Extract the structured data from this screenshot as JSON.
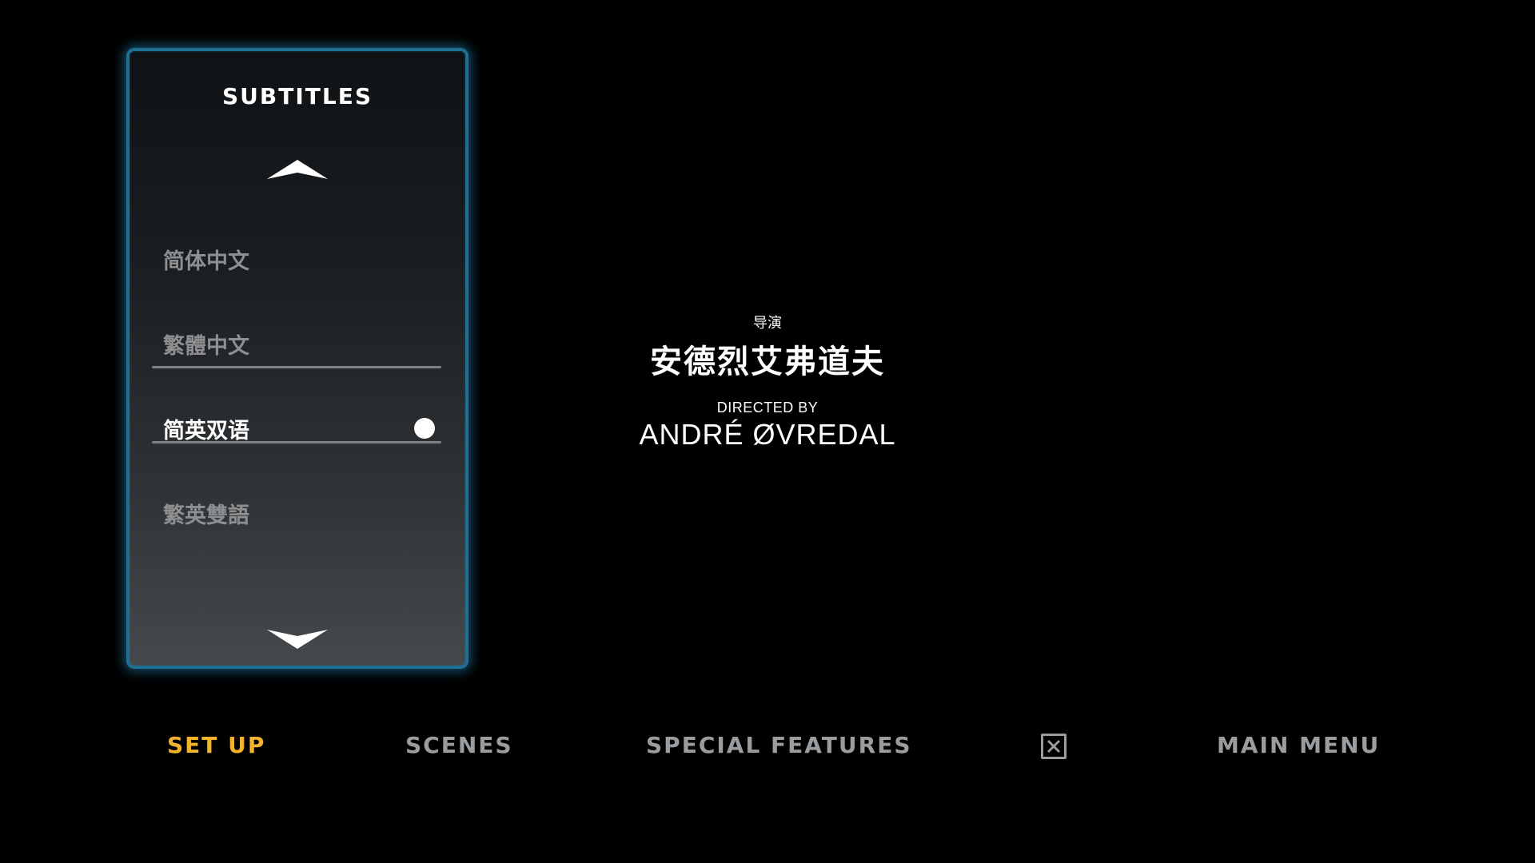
{
  "subtitles_panel": {
    "title": "SUBTITLES",
    "up_icon": "chevron-up-icon",
    "down_icon": "chevron-down-icon",
    "options": [
      {
        "label": "简体中文",
        "selected": false
      },
      {
        "label": "繁體中文",
        "selected": false
      },
      {
        "label": "简英双语",
        "selected": true
      },
      {
        "label": "繁英雙語",
        "selected": false
      }
    ],
    "accent_color": "#1f6f94"
  },
  "credits": {
    "role_cn": "导演",
    "name_cn": "安德烈艾弗道夫",
    "role_en": "DIRECTED BY",
    "name_en": "ANDRÉ ØVREDAL"
  },
  "nav": {
    "setup": "SET UP",
    "scenes": "SCENES",
    "special_features": "SPECIAL FEATURES",
    "close_icon": "close-x-icon",
    "main_menu": "MAIN MENU",
    "active_color": "#f3b42d",
    "inactive_color": "#9a9da0"
  }
}
